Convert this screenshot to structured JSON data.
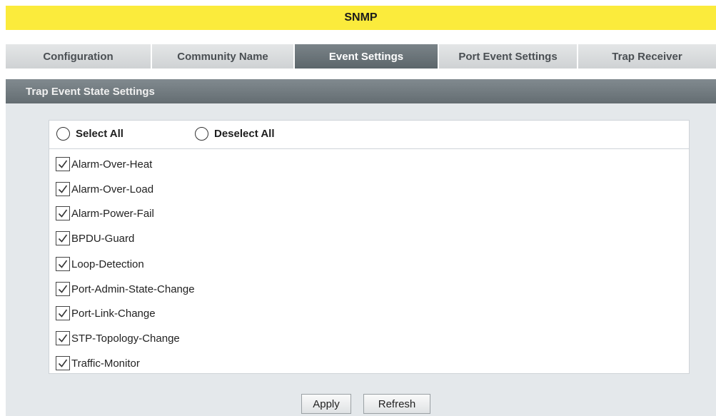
{
  "header": {
    "title": "SNMP"
  },
  "tabs": [
    {
      "label": "Configuration",
      "active": false
    },
    {
      "label": "Community Name",
      "active": false
    },
    {
      "label": "Event Settings",
      "active": true
    },
    {
      "label": "Port Event Settings",
      "active": false
    },
    {
      "label": "Trap Receiver",
      "active": false
    }
  ],
  "section": {
    "title": "Trap Event State Settings"
  },
  "selection": {
    "select_all": "Select All",
    "deselect_all": "Deselect All"
  },
  "events": [
    {
      "label": "Alarm-Over-Heat",
      "checked": true
    },
    {
      "label": "Alarm-Over-Load",
      "checked": true
    },
    {
      "label": "Alarm-Power-Fail",
      "checked": true
    },
    {
      "label": "BPDU-Guard",
      "checked": true
    },
    {
      "label": "Loop-Detection",
      "checked": true
    },
    {
      "label": "Port-Admin-State-Change",
      "checked": true
    },
    {
      "label": "Port-Link-Change",
      "checked": true
    },
    {
      "label": "STP-Topology-Change",
      "checked": true
    },
    {
      "label": "Traffic-Monitor",
      "checked": true
    }
  ],
  "buttons": {
    "apply": "Apply",
    "refresh": "Refresh"
  },
  "colors": {
    "title_bar": "#fbeb3c",
    "active_tab": "#646d72",
    "inactive_tab": "#d8dbdd",
    "section_header": "#6e777c",
    "content_bg": "#e4e8eb"
  }
}
